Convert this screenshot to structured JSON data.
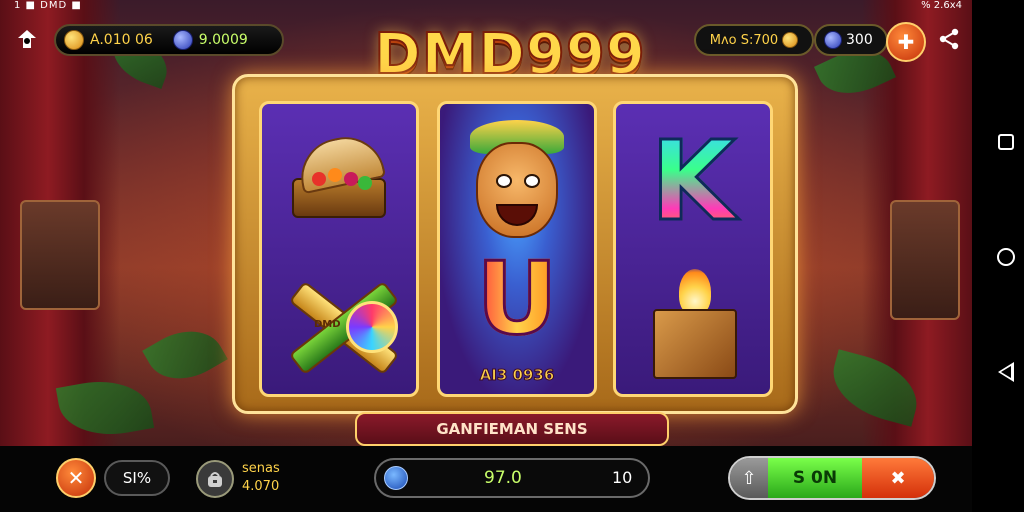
{
  "status_bar": {
    "left": "1 ■ DMD ■",
    "right": "% 2.6x4"
  },
  "hud": {
    "wallet_value_1": "A.010 06",
    "wallet_value_2": "9.0009",
    "title": "DMD999",
    "right_pill_text": "Mʌo S:700",
    "gems_value": "300",
    "gift_icon_glyph": "✚"
  },
  "reels": {
    "reel2_caption": "AI3 0936",
    "k_letter": "K",
    "u_letter": "U",
    "x_bar_text": "DMD"
  },
  "banner": {
    "text": "GANFIEMAN SENS"
  },
  "bottom_bar": {
    "close_glyph": "✕",
    "percent": "SI%",
    "series_label": "senas",
    "series_value": "4.070",
    "bet_value": "97.0",
    "bet_end": "10",
    "spin_up_glyph": "⇧",
    "spin_label": "S 0N",
    "spin_end_glyph": "✖"
  },
  "colors": {
    "accent_gold": "#ffd34a",
    "spin_green": "#2aa81a",
    "action_orange": "#d4300a",
    "reel_purple": "#5b2fb3"
  }
}
